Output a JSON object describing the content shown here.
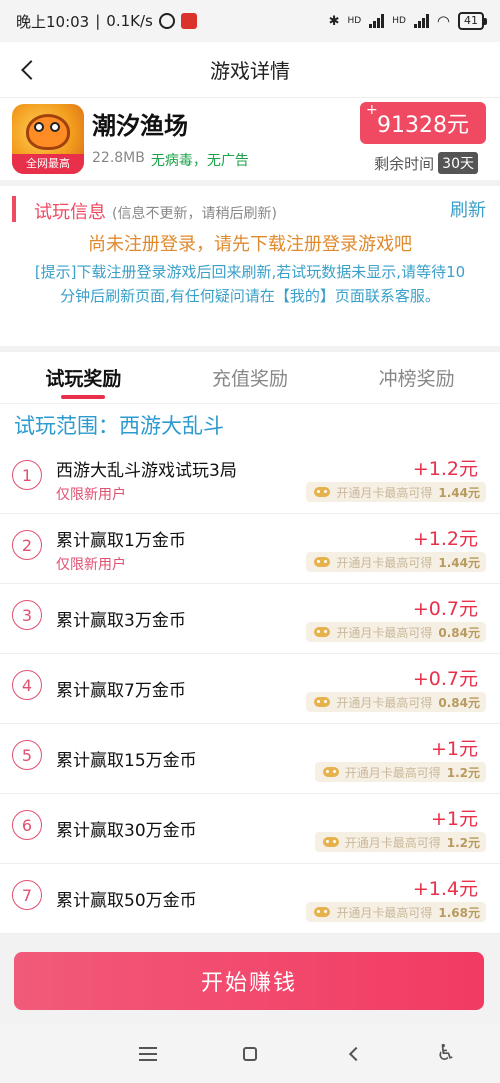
{
  "status_bar": {
    "time": "晚上10:03",
    "speed": "0.1K/s",
    "network_left": "HD",
    "network_right": "HD",
    "battery": "41"
  },
  "header": {
    "title": "游戏详情"
  },
  "game": {
    "name": "潮汐渔场",
    "badge": "全网最高",
    "size": "22.8MB",
    "safety": "无病毒，无广告",
    "price_plus": "+",
    "price": "91328元",
    "remaining_label": "剩余时间",
    "remaining_days": "30天"
  },
  "info": {
    "title": "试玩信息",
    "subtitle": "(信息不更新，请稍后刷新)",
    "refresh": "刷新",
    "warning": "尚未注册登录，请先下载注册登录游戏吧",
    "tip": "[提示]下载注册登录游戏后回来刷新,若试玩数据未显示,请等待10分钟后刷新页面,有任何疑问请在【我的】页面联系客服。"
  },
  "tabs": [
    {
      "label": "试玩奖励"
    },
    {
      "label": "充值奖励"
    },
    {
      "label": "冲榜奖励"
    }
  ],
  "scope": "试玩范围：西游大乱斗",
  "rewards": [
    {
      "num": "1",
      "title": "西游大乱斗游戏试玩3局",
      "note": "仅限新用户",
      "amount": "+1.2元",
      "card_text": "开通月卡最高可得",
      "card_value": "1.44元"
    },
    {
      "num": "2",
      "title": "累计赢取1万金币",
      "note": "仅限新用户",
      "amount": "+1.2元",
      "card_text": "开通月卡最高可得",
      "card_value": "1.44元"
    },
    {
      "num": "3",
      "title": "累计赢取3万金币",
      "note": "",
      "amount": "+0.7元",
      "card_text": "开通月卡最高可得",
      "card_value": "0.84元"
    },
    {
      "num": "4",
      "title": "累计赢取7万金币",
      "note": "",
      "amount": "+0.7元",
      "card_text": "开通月卡最高可得",
      "card_value": "0.84元"
    },
    {
      "num": "5",
      "title": "累计赢取15万金币",
      "note": "",
      "amount": "+1元",
      "card_text": "开通月卡最高可得",
      "card_value": "1.2元"
    },
    {
      "num": "6",
      "title": "累计赢取30万金币",
      "note": "",
      "amount": "+1元",
      "card_text": "开通月卡最高可得",
      "card_value": "1.2元"
    },
    {
      "num": "7",
      "title": "累计赢取50万金币",
      "note": "",
      "amount": "+1.4元",
      "card_text": "开通月卡最高可得",
      "card_value": "1.68元"
    }
  ],
  "start_button": "开始赚钱",
  "colors": {
    "accent": "#e8304a",
    "link": "#3aa0c8",
    "warning": "#e08a2e",
    "safe": "#1aa34a"
  }
}
